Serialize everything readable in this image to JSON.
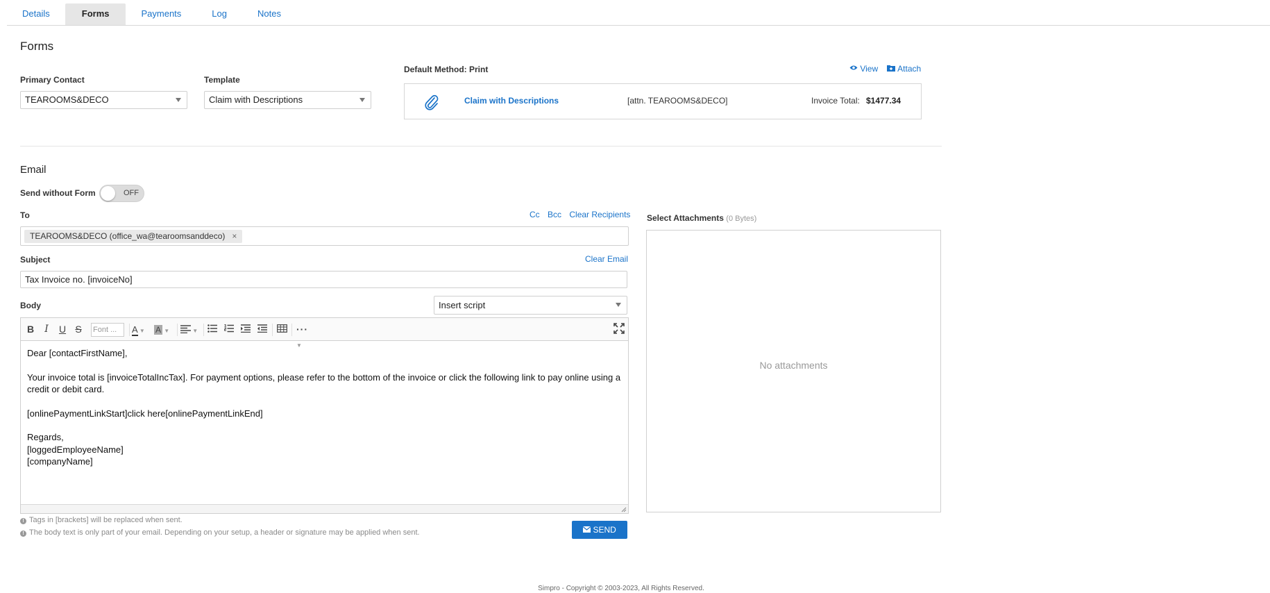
{
  "tabs": [
    "Details",
    "Forms",
    "Payments",
    "Log",
    "Notes"
  ],
  "forms": {
    "title": "Forms",
    "primary_contact_label": "Primary Contact",
    "primary_contact_value": "TEAROOMS&DECO",
    "template_label": "Template",
    "template_value": "Claim with Descriptions",
    "default_method": "Default Method: Print",
    "view_label": "View",
    "attach_label": "Attach",
    "invoice": {
      "name": "Claim with Descriptions",
      "attn": "[attn. TEAROOMS&DECO]",
      "total_label": "Invoice Total:",
      "total_value": "$1477.34"
    }
  },
  "email": {
    "title": "Email",
    "send_without_form_label": "Send without Form",
    "toggle_state": "OFF",
    "to_label": "To",
    "cc": "Cc",
    "bcc": "Bcc",
    "clear_recipients": "Clear Recipients",
    "recipient_chip": "TEAROOMS&DECO (office_wa@tearoomsanddeco)",
    "recipient_remove": "×",
    "subject_label": "Subject",
    "clear_email": "Clear Email",
    "subject_value": "Tax Invoice no. [invoiceNo]",
    "body_label": "Body",
    "insert_script": "Insert script",
    "font_placeholder": "Font ...",
    "body": {
      "greeting": "Dear [contactFirstName],",
      "paragraph": "Your invoice total is [invoiceTotalIncTax]. For payment options, please refer to the bottom of the invoice or click the following link to pay online using a credit or debit card.",
      "link_line": "[onlinePaymentLinkStart]click here[onlinePaymentLinkEnd]",
      "regards": "Regards,",
      "employee": "[loggedEmployeeName]",
      "company": "[companyName]"
    },
    "note1": "Tags in [brackets] will be replaced when sent.",
    "note2": "The body text is only part of your email. Depending on your setup, a header or signature may be applied when sent.",
    "send_label": "SEND"
  },
  "attachments": {
    "label": "Select Attachments",
    "size": "(0 Bytes)",
    "empty": "No attachments"
  },
  "footer": "Simpro - Copyright © 2003-2023, All Rights Reserved."
}
